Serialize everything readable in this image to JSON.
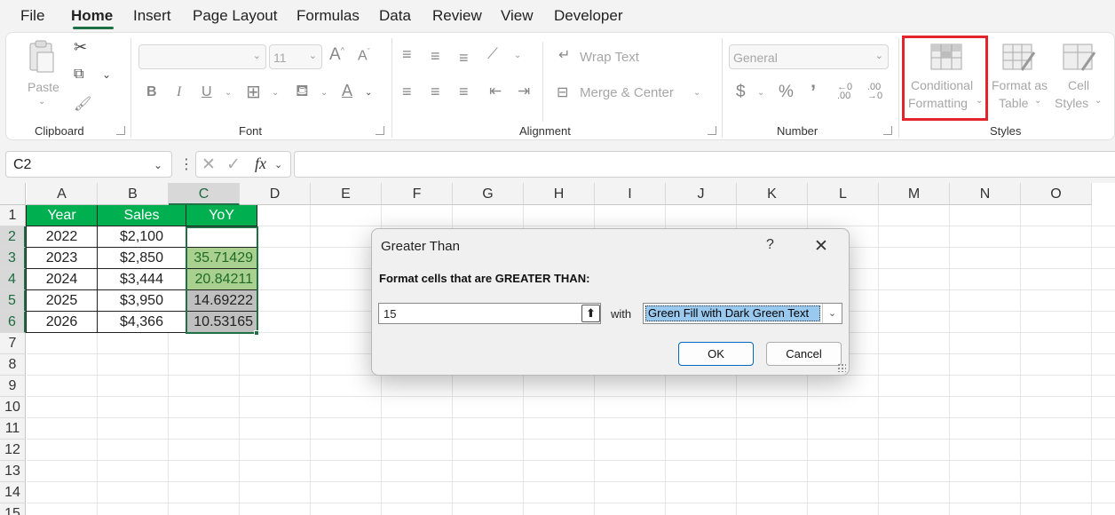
{
  "menu": {
    "tabs": [
      "File",
      "Home",
      "Insert",
      "Page Layout",
      "Formulas",
      "Data",
      "Review",
      "View",
      "Developer"
    ],
    "active": "Home"
  },
  "ribbon": {
    "clipboard": {
      "label": "Clipboard",
      "paste": "Paste"
    },
    "font": {
      "label": "Font",
      "size": "11",
      "bold": "B",
      "italic": "I",
      "underline": "U"
    },
    "alignment": {
      "label": "Alignment",
      "wrap_text": "Wrap Text",
      "merge_center": "Merge & Center"
    },
    "number": {
      "label": "Number",
      "format": "General",
      "currency": "$",
      "percent": "%",
      "comma": "’",
      "inc_decimal": "←.0\n.00",
      "dec_decimal": ".00\n→.0"
    },
    "styles": {
      "label": "Styles",
      "conditional_formatting": [
        "Conditional",
        "Formatting"
      ],
      "format_as_table": [
        "Format as",
        "Table"
      ],
      "cell_styles": [
        "Cell",
        "Styles"
      ]
    }
  },
  "formula_bar": {
    "name_box": "C2",
    "fx": "fx",
    "value": ""
  },
  "sheet": {
    "columns": [
      "A",
      "B",
      "C",
      "D",
      "E",
      "F",
      "G",
      "H",
      "I",
      "J",
      "K",
      "L",
      "M",
      "N",
      "O"
    ],
    "selected_column": "C",
    "rows": [
      "1",
      "2",
      "3",
      "4",
      "5",
      "6",
      "7",
      "8",
      "9",
      "10",
      "11",
      "12",
      "13",
      "14",
      "15"
    ],
    "selected_rows": [
      "2",
      "3",
      "4",
      "5",
      "6"
    ],
    "header": [
      "Year",
      "Sales",
      "YoY"
    ],
    "data": [
      [
        "2022",
        "$2,100",
        ""
      ],
      [
        "2023",
        "$2,850",
        "35.71429"
      ],
      [
        "2024",
        "$3,444",
        "20.84211"
      ],
      [
        "2025",
        "$3,950",
        "14.69222"
      ],
      [
        "2026",
        "$4,366",
        "10.53165"
      ]
    ],
    "header_color": "#00b050",
    "highlight_green": "#a9d08e",
    "highlight_gray": "#bfbfbf"
  },
  "dialog": {
    "title": "Greater Than",
    "help": "?",
    "close": "✕",
    "prompt": "Format cells that are GREATER THAN:",
    "value": "15",
    "with_label": "with",
    "format_option": "Green Fill with Dark Green Text",
    "ok": "OK",
    "cancel": "Cancel"
  },
  "colors": {
    "accent": "#1e7145",
    "highlight_box": "#e3242b"
  }
}
